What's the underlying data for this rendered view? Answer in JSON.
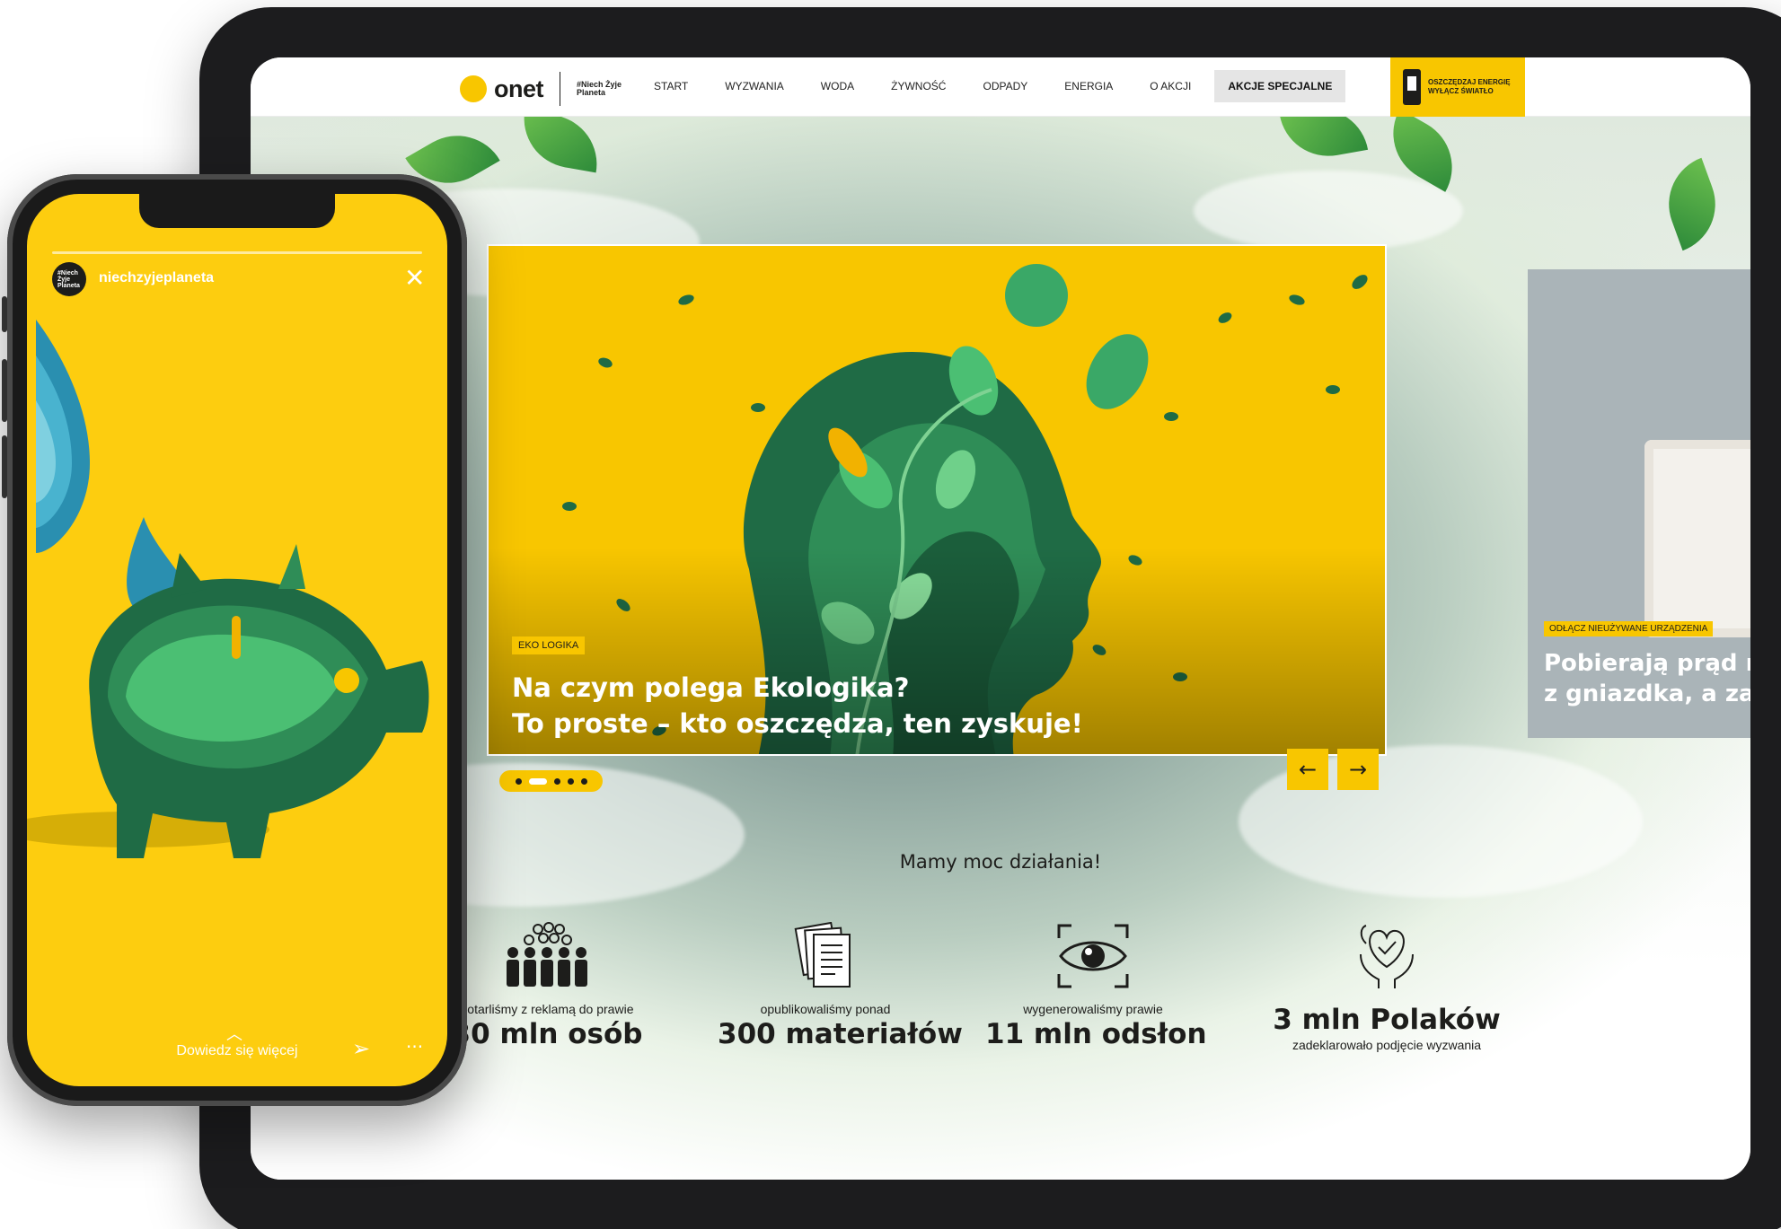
{
  "site": {
    "logo": {
      "brand": "onet",
      "sub": "#Niech Żyje Planeta"
    },
    "nav": [
      "START",
      "WYZWANIA",
      "WODA",
      "ŻYWNOŚĆ",
      "ODPADY",
      "ENERGIA",
      "O AKCJI"
    ],
    "nav_special": "AKCJE SPECJALNE",
    "promo": {
      "line1": "OSZCZĘDZAJ ENERGIĘ",
      "line2": "WYŁĄCZ ŚWIATŁO"
    }
  },
  "slider": {
    "tag": "EKO LOGIKA",
    "title_line1": "Na czym polega Ekologika?",
    "title_line2": "To proste – kto oszczędza, ten zyskuje!",
    "next_tag": "ODŁĄCZ NIEUŻYWANE URZĄDZENIA",
    "next_title_line1": "Pobierają prąd n",
    "next_title_line2": "z gniazdka, a zas",
    "prev_icon": "←",
    "next_icon": "→"
  },
  "stats": {
    "heading": "Mamy moc działania!",
    "items": [
      {
        "icon": "people-crowd-icon",
        "pre": "dotarliśmy z reklamą do prawie",
        "value": "30 mln osób",
        "post": ""
      },
      {
        "icon": "documents-icon",
        "pre": "opublikowaliśmy ponad",
        "value": "300 materiałów",
        "post": ""
      },
      {
        "icon": "eye-icon",
        "pre": "wygenerowaliśmy prawie",
        "value": "11 mln odsłon",
        "post": ""
      },
      {
        "icon": "hands-heart-icon",
        "pre": "",
        "value": "3 mln Polaków",
        "post": "zadeklarowało podjęcie wyzwania"
      }
    ]
  },
  "story": {
    "avatar_text": "#Niech Żyje Planeta",
    "username": "niechzyjeplaneta",
    "close": "✕",
    "chevron": "︿",
    "cta": "Dowiedz się więcej",
    "send": "➢",
    "more": "···"
  },
  "colors": {
    "accent": "#f8c600",
    "story_bg": "#fdcd0f",
    "green_dark": "#1f6b45",
    "green_light": "#3aa867"
  }
}
